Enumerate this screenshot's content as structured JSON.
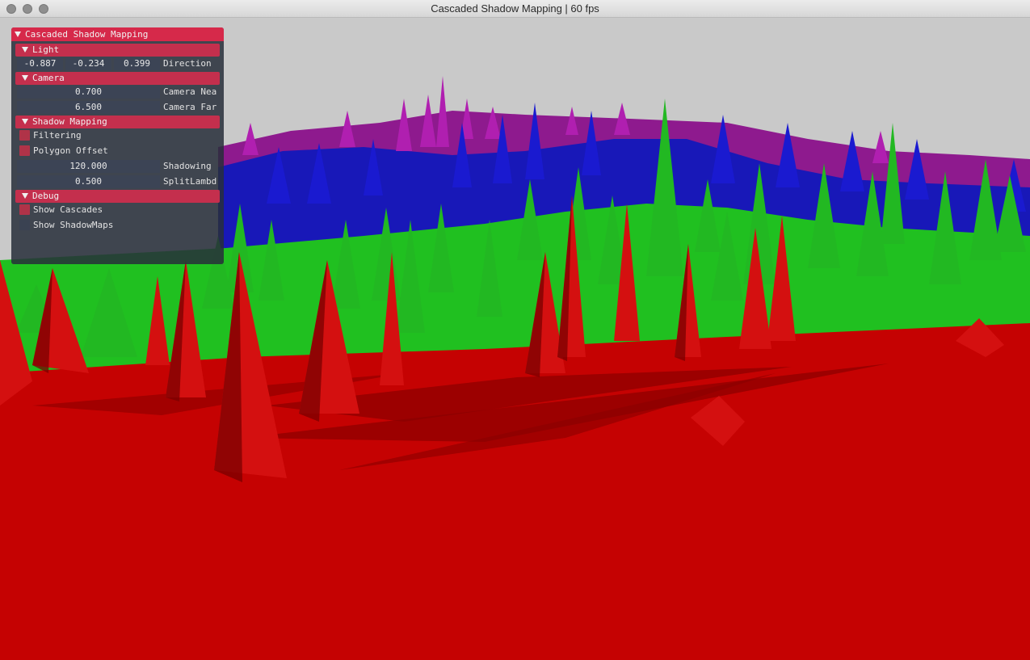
{
  "window": {
    "title": "Cascaded Shadow Mapping | 60 fps"
  },
  "panel": {
    "title": "Cascaded Shadow Mapping",
    "sections": {
      "light": {
        "label": "Light",
        "direction": {
          "x": "-0.887",
          "y": "-0.234",
          "z": "0.399",
          "label": "Direction"
        }
      },
      "camera": {
        "label": "Camera",
        "near": {
          "value": "0.700",
          "label": "Camera Nea"
        },
        "far": {
          "value": "6.500",
          "label": "Camera Far"
        }
      },
      "shadow_mapping": {
        "label": "Shadow Mapping",
        "filtering": {
          "label": "Filtering",
          "checked": true
        },
        "polygon_offset": {
          "label": "Polygon Offset",
          "checked": true
        },
        "shadowing": {
          "value": "120.000",
          "label": "Shadowing"
        },
        "split_lambda": {
          "value": "0.500",
          "label": "SplitLambd"
        }
      },
      "debug": {
        "label": "Debug",
        "show_cascades": {
          "label": "Show Cascades",
          "checked": true
        },
        "show_shadowmaps": {
          "label": "Show ShadowMaps",
          "checked": false
        }
      }
    }
  },
  "scene": {
    "description_colors": {
      "sky": "#c8c8c8",
      "cascade_near": "#c00000",
      "cascade_2": "#1bb81b",
      "cascade_3": "#1414c8",
      "cascade_far": "#b41eb4"
    }
  }
}
